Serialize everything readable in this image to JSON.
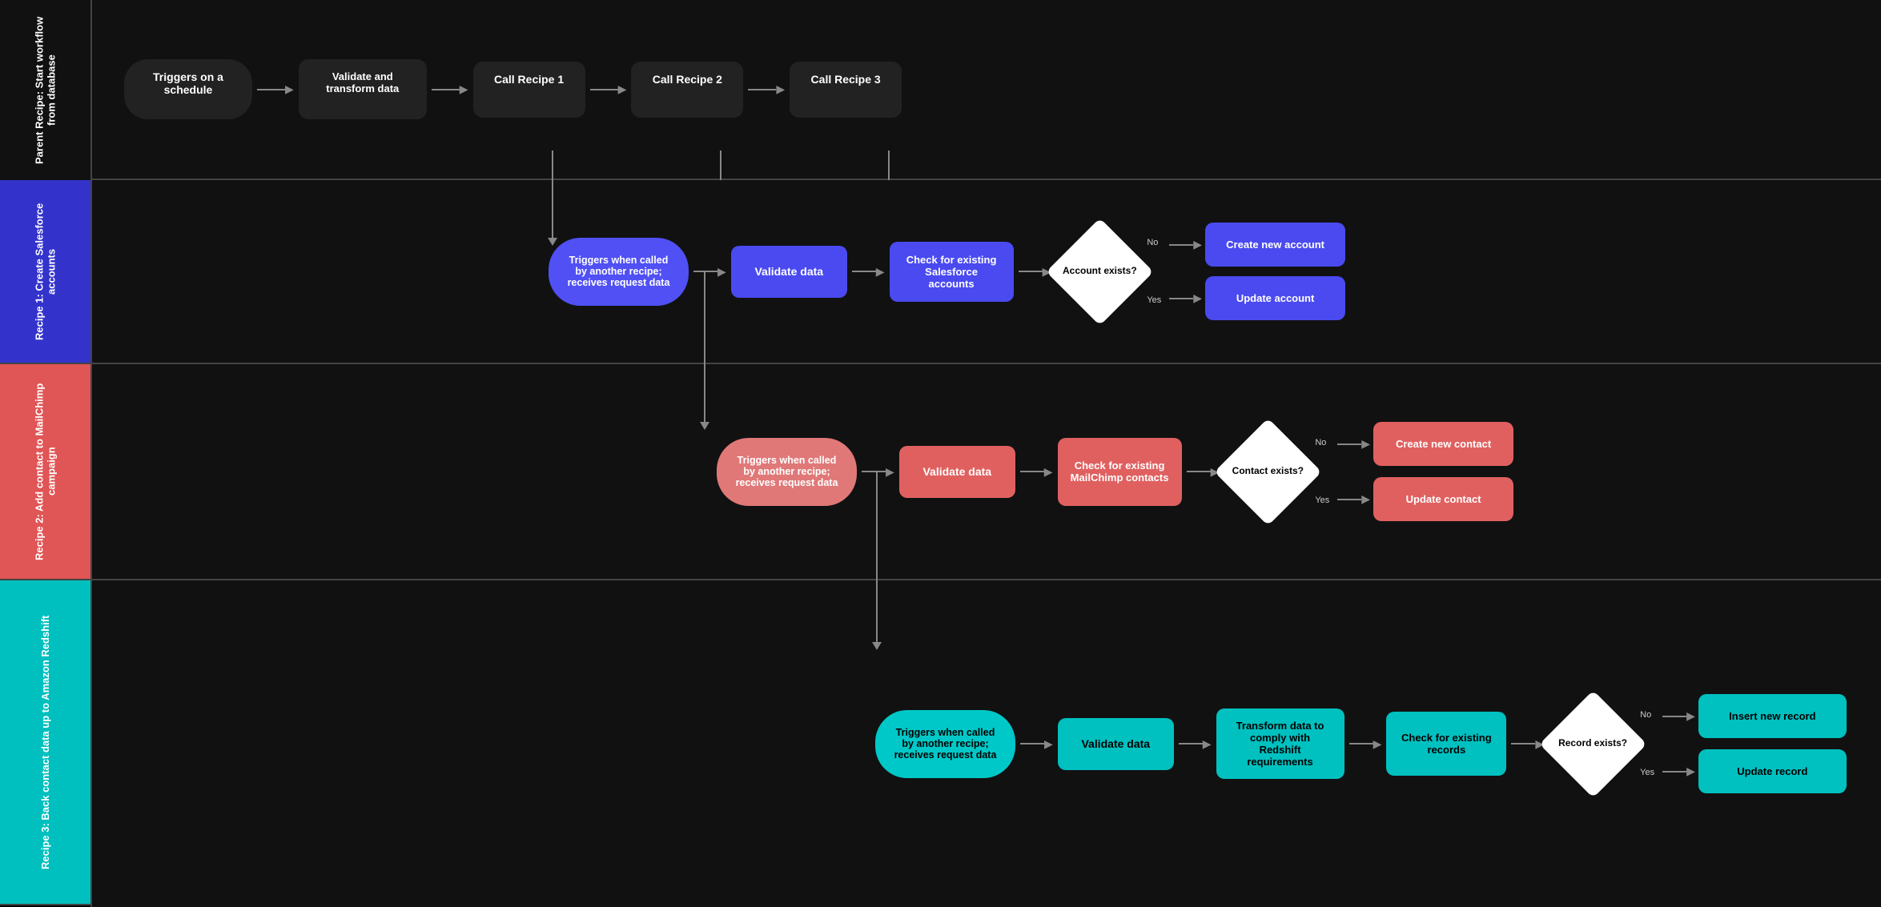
{
  "rows": [
    {
      "label": "Parent Recipe: Start workflow from database",
      "labelColor": "#111",
      "nodes": [
        {
          "text": "Triggers on a schedule",
          "type": "dark-pill"
        },
        {
          "text": "Validate and transform data",
          "type": "dark"
        },
        {
          "text": "Call Recipe 1",
          "type": "dark"
        },
        {
          "text": "Call Recipe 2",
          "type": "dark"
        },
        {
          "text": "Call Recipe 3",
          "type": "dark"
        }
      ]
    },
    {
      "label": "Recipe 1: Create Salesforce accounts",
      "labelColor": "#3333cc",
      "nodes": [
        {
          "text": "Triggers when called by another recipe; receives request data",
          "type": "blue-pill"
        },
        {
          "text": "Validate data",
          "type": "blue"
        },
        {
          "text": "Check for existing Salesforce accounts",
          "type": "blue"
        },
        {
          "text": "Account exists?",
          "type": "diamond"
        },
        {
          "text": "Create new account",
          "type": "blue",
          "branch": "no"
        },
        {
          "text": "Update account",
          "type": "blue",
          "branch": "yes"
        }
      ]
    },
    {
      "label": "Recipe 2: Add contact to MailChimp campaign",
      "labelColor": "#e05555",
      "nodes": [
        {
          "text": "Triggers when called by another recipe; receives request data",
          "type": "pink-pill"
        },
        {
          "text": "Validate data",
          "type": "pink"
        },
        {
          "text": "Check for existing MailChimp contacts",
          "type": "pink"
        },
        {
          "text": "Contact exists?",
          "type": "diamond-pink"
        },
        {
          "text": "Create new contact",
          "type": "pink",
          "branch": "no"
        },
        {
          "text": "Update contact",
          "type": "pink",
          "branch": "yes"
        }
      ]
    },
    {
      "label": "Recipe 3: Back contact data up to Amazon Redshift",
      "labelColor": "#00bfbf",
      "nodes": [
        {
          "text": "Triggers when called by another recipe; receives request data",
          "type": "teal-pill"
        },
        {
          "text": "Validate data",
          "type": "teal"
        },
        {
          "text": "Transform data to comply with Redshift requirements",
          "type": "teal"
        },
        {
          "text": "Check for existing records",
          "type": "teal"
        },
        {
          "text": "Record exists?",
          "type": "diamond-teal"
        },
        {
          "text": "Insert new record",
          "type": "teal",
          "branch": "no"
        },
        {
          "text": "Update record",
          "type": "teal",
          "branch": "yes"
        }
      ]
    }
  ],
  "colors": {
    "dark": "#222",
    "darkBorder": "#555",
    "blue": "#3a3aee",
    "bluePill": "#5050f5",
    "pink": "#e06060",
    "pinkPill": "#e07878",
    "teal": "#00c8c8",
    "tealPill": "#00d8d8",
    "arrow": "#888",
    "labelText": "#fff",
    "diamondBg": "#fff",
    "diamondText": "#000"
  }
}
